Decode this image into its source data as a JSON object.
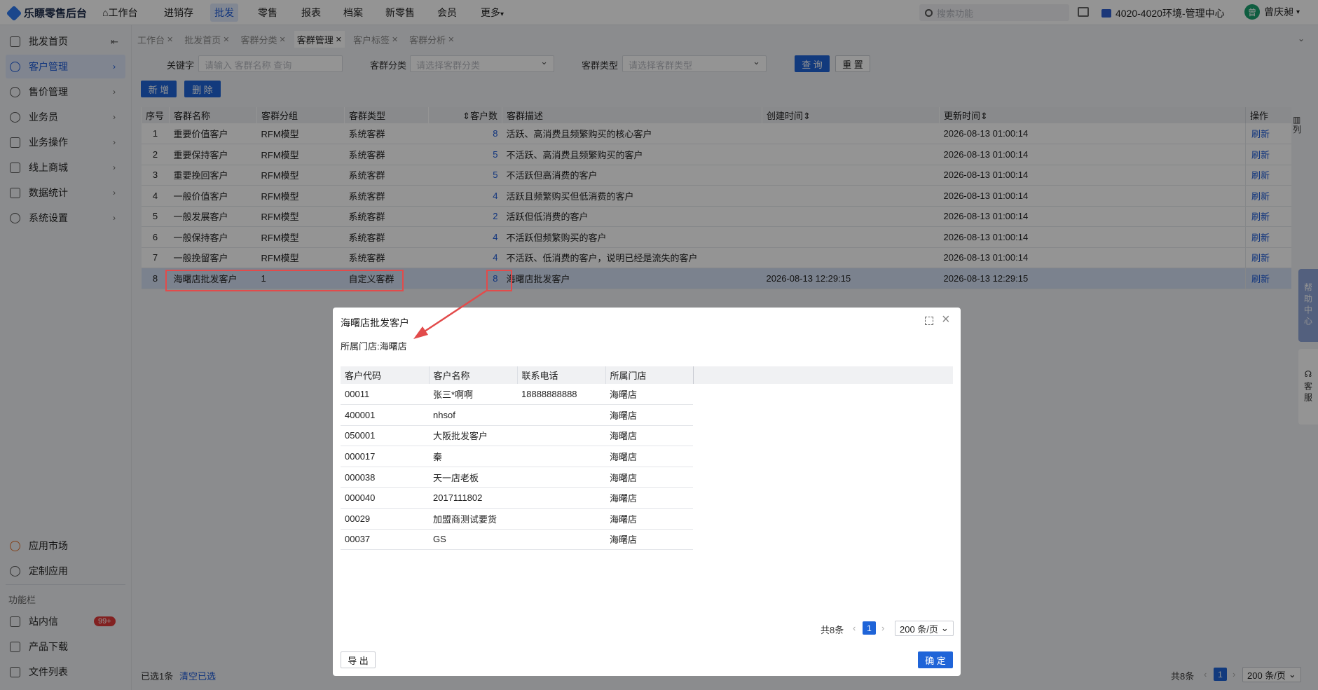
{
  "app": {
    "title": "乐瞟零售后台"
  },
  "topnav": [
    {
      "label": "工作台"
    },
    {
      "label": "进销存"
    },
    {
      "label": "批发"
    },
    {
      "label": "零售"
    },
    {
      "label": "报表"
    },
    {
      "label": "档案"
    },
    {
      "label": "新零售"
    },
    {
      "label": "会员"
    },
    {
      "label": "更多"
    }
  ],
  "search": {
    "placeholder": "搜索功能"
  },
  "env": {
    "label": "4020-4020环境-管理中心"
  },
  "user": {
    "avatar": "曾",
    "name": "曾庆昶"
  },
  "sidebar": {
    "items": [
      {
        "label": "批发首页"
      },
      {
        "label": "客户管理"
      },
      {
        "label": "售价管理"
      },
      {
        "label": "业务员"
      },
      {
        "label": "业务操作"
      },
      {
        "label": "线上商城"
      },
      {
        "label": "数据统计"
      },
      {
        "label": "系统设置"
      }
    ],
    "bottom": [
      {
        "label": "应用市场"
      },
      {
        "label": "定制应用"
      }
    ],
    "func_title": "功能栏",
    "func": [
      {
        "label": "站内信"
      },
      {
        "label": "产品下载"
      },
      {
        "label": "文件列表"
      }
    ],
    "badge": "99+"
  },
  "tabs": [
    {
      "label": "工作台"
    },
    {
      "label": "批发首页"
    },
    {
      "label": "客群分类"
    },
    {
      "label": "客群管理"
    },
    {
      "label": "客户标签"
    },
    {
      "label": "客群分析"
    }
  ],
  "filters": {
    "keyword_label": "关键字",
    "keyword_placeholder": "请输入 客群名称 查询",
    "category_label": "客群分类",
    "category_placeholder": "请选择客群分类",
    "type_label": "客群类型",
    "type_placeholder": "请选择客群类型",
    "query": "查 询",
    "reset": "重 置"
  },
  "actions": {
    "add": "新 增",
    "delete": "删 除"
  },
  "table": {
    "headers": [
      "序号",
      "客群名称",
      "客群分组",
      "客群类型",
      "客户数",
      "客群描述",
      "创建时间",
      "更新时间",
      "操作"
    ],
    "rows": [
      {
        "no": "1",
        "name": "重要价值客户",
        "group": "RFM模型",
        "type": "系统客群",
        "count": "8",
        "desc": "活跃、高消费且频繁购买的核心客户",
        "created": "",
        "updated": "2026-08-13 01:00:14",
        "op": "刷新"
      },
      {
        "no": "2",
        "name": "重要保持客户",
        "group": "RFM模型",
        "type": "系统客群",
        "count": "5",
        "desc": "不活跃、高消费且频繁购买的客户",
        "created": "",
        "updated": "2026-08-13 01:00:14",
        "op": "刷新"
      },
      {
        "no": "3",
        "name": "重要挽回客户",
        "group": "RFM模型",
        "type": "系统客群",
        "count": "5",
        "desc": "不活跃但高消费的客户",
        "created": "",
        "updated": "2026-08-13 01:00:14",
        "op": "刷新"
      },
      {
        "no": "4",
        "name": "一般价值客户",
        "group": "RFM模型",
        "type": "系统客群",
        "count": "4",
        "desc": "活跃且频繁购买但低消费的客户",
        "created": "",
        "updated": "2026-08-13 01:00:14",
        "op": "刷新"
      },
      {
        "no": "5",
        "name": "一般发展客户",
        "group": "RFM模型",
        "type": "系统客群",
        "count": "2",
        "desc": "活跃但低消费的客户",
        "created": "",
        "updated": "2026-08-13 01:00:14",
        "op": "刷新"
      },
      {
        "no": "6",
        "name": "一般保持客户",
        "group": "RFM模型",
        "type": "系统客群",
        "count": "4",
        "desc": "不活跃但频繁购买的客户",
        "created": "",
        "updated": "2026-08-13 01:00:14",
        "op": "刷新"
      },
      {
        "no": "7",
        "name": "一般挽留客户",
        "group": "RFM模型",
        "type": "系统客群",
        "count": "4",
        "desc": "不活跃、低消费的客户，说明已经是流失的客户",
        "created": "",
        "updated": "2026-08-13 01:00:14",
        "op": "刷新"
      },
      {
        "no": "8",
        "name": "海曙店批发客户",
        "group": "1",
        "type": "自定义客群",
        "count": "8",
        "desc": "海曙店批发客户",
        "created": "2026-08-13 12:29:15",
        "updated": "2026-08-13 12:29:15",
        "op": "刷新"
      }
    ],
    "column_setting": "列"
  },
  "footer": {
    "selected": "已选1条",
    "clear": "清空已选",
    "total": "共8条",
    "page": "1",
    "page_size": "200 条/页"
  },
  "float": {
    "help": "帮助中心",
    "service": "客服"
  },
  "modal": {
    "title": "海曙店批发客户",
    "store": "所属门店:海曙店",
    "headers": [
      "客户代码",
      "客户名称",
      "联系电话",
      "所属门店"
    ],
    "rows": [
      {
        "code": "00011",
        "name": "张三*啊啊",
        "phone": "18888888888",
        "store": "海曙店"
      },
      {
        "code": "400001",
        "name": "nhsof",
        "phone": "",
        "store": "海曙店"
      },
      {
        "code": "050001",
        "name": "大阪批发客户",
        "phone": "",
        "store": "海曙店"
      },
      {
        "code": "000017",
        "name": "秦",
        "phone": "",
        "store": "海曙店"
      },
      {
        "code": "000038",
        "name": "天一店老板",
        "phone": "",
        "store": "海曙店"
      },
      {
        "code": "000040",
        "name": "2017111802",
        "phone": "",
        "store": "海曙店"
      },
      {
        "code": "00029",
        "name": "加盟商测试要货",
        "phone": "",
        "store": "海曙店"
      },
      {
        "code": "00037",
        "name": "GS",
        "phone": "",
        "store": "海曙店"
      }
    ],
    "total": "共8条",
    "page": "1",
    "page_size": "200 条/页",
    "export": "导 出",
    "ok": "确 定"
  },
  "colors": {
    "primary": "#1f64d8",
    "annotation": "#e24b4b",
    "selected_row": "#d5e1f5"
  }
}
